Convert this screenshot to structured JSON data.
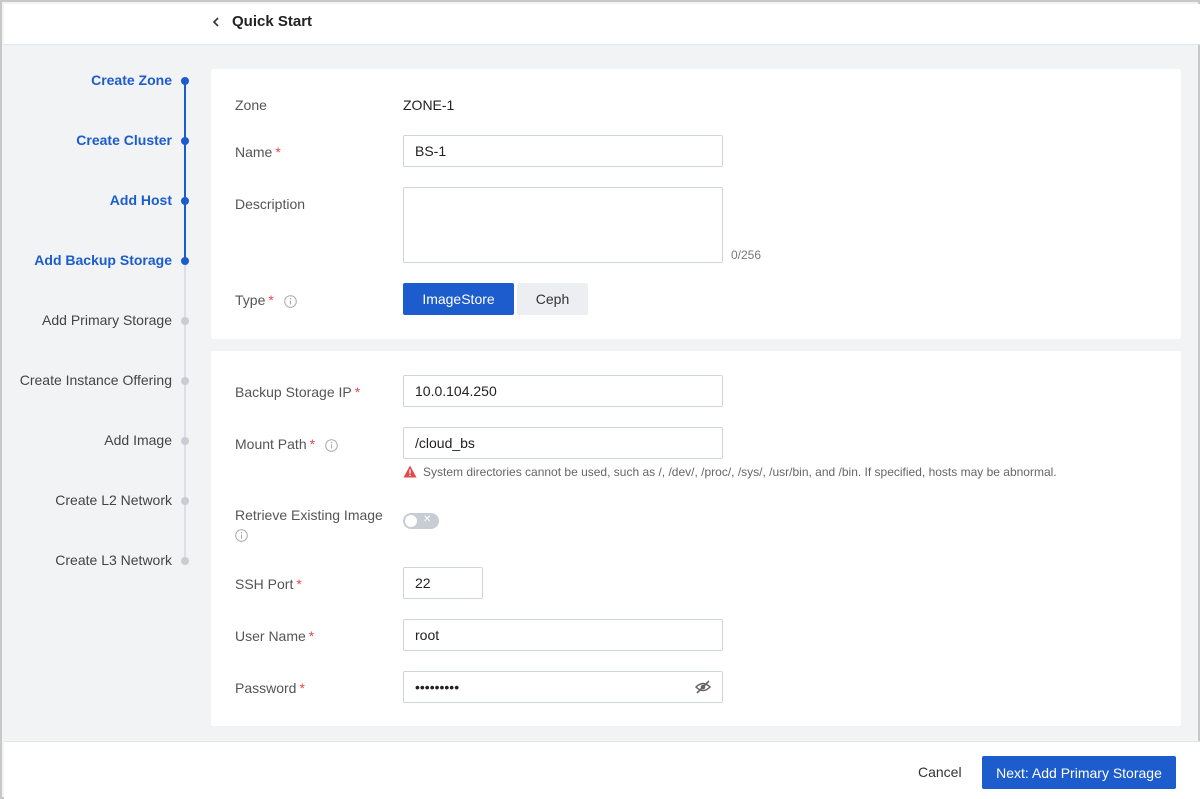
{
  "header": {
    "title": "Quick Start"
  },
  "steps": [
    {
      "label": "Create Zone",
      "active": true
    },
    {
      "label": "Create Cluster",
      "active": true
    },
    {
      "label": "Add Host",
      "active": true
    },
    {
      "label": "Add Backup Storage",
      "active": true
    },
    {
      "label": "Add Primary Storage",
      "active": false
    },
    {
      "label": "Create Instance Offering",
      "active": false
    },
    {
      "label": "Add Image",
      "active": false
    },
    {
      "label": "Create L2 Network",
      "active": false
    },
    {
      "label": "Create L3 Network",
      "active": false
    }
  ],
  "form1": {
    "zone_label": "Zone",
    "zone_value": "ZONE-1",
    "name_label": "Name",
    "name_value": "BS-1",
    "description_label": "Description",
    "description_value": "",
    "description_counter": "0/256",
    "type_label": "Type",
    "type_options": [
      "ImageStore",
      "Ceph"
    ],
    "type_selected": "ImageStore"
  },
  "form2": {
    "ip_label": "Backup Storage IP",
    "ip_value": "10.0.104.250",
    "mount_label": "Mount Path",
    "mount_value": "/cloud_bs",
    "mount_warning": "System directories cannot be used, such as /, /dev/, /proc/, /sys/, /usr/bin, and /bin. If specified, hosts may be abnormal.",
    "retrieve_label": "Retrieve Existing Image",
    "retrieve_enabled": false,
    "ssh_label": "SSH Port",
    "ssh_value": "22",
    "user_label": "User Name",
    "user_value": "root",
    "password_label": "Password",
    "password_value": "•••••••••"
  },
  "footer": {
    "cancel_label": "Cancel",
    "next_label": "Next: Add Primary Storage"
  },
  "colors": {
    "accent": "#1c5ccc",
    "required": "#e5484d",
    "warning": "#e5484d"
  }
}
